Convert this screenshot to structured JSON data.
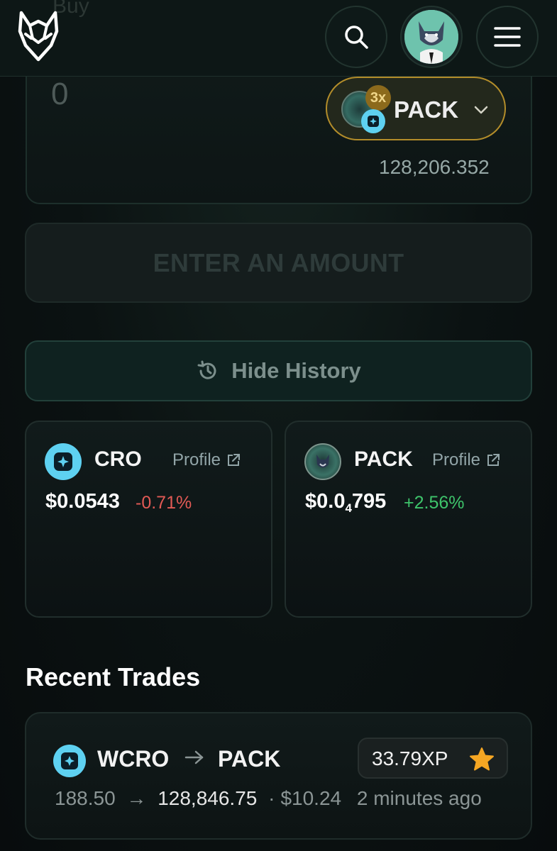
{
  "header": {
    "ghost_label": "Buy",
    "logo_icon": "fox-logo-icon",
    "search_icon": "search-icon",
    "avatar_icon": "wolf-avatar-icon",
    "menu_icon": "hamburger-menu-icon"
  },
  "buy": {
    "amount": "0",
    "token": {
      "symbol": "PACK",
      "multiplier": "3x",
      "icon": "pack-token-icon",
      "chain_icon": "cro-chain-icon"
    },
    "balance": "128,206.352"
  },
  "actions": {
    "enter_amount": "ENTER AN AMOUNT",
    "hide_history": "Hide History"
  },
  "tokens": [
    {
      "symbol": "CRO",
      "profile_label": "Profile",
      "price": "$0.0543",
      "change": "-0.71%",
      "direction": "down",
      "color": "#e25a55"
    },
    {
      "symbol": "PACK",
      "profile_label": "Profile",
      "price_prefix": "$0.0",
      "price_subscript": "4",
      "price_suffix": "795",
      "change": "+2.56%",
      "direction": "up",
      "color": "#3ec46b"
    }
  ],
  "recent_trades": {
    "title": "Recent Trades",
    "items": [
      {
        "from": "WCRO",
        "to": "PACK",
        "xp": "33.79XP",
        "amount_in": "188.50",
        "amount_out": "128,846.75",
        "usd": "$10.24",
        "time": "2 minutes ago"
      }
    ]
  },
  "colors": {
    "accent_gold": "#b38d2a",
    "cro_blue": "#5ed1f1",
    "positive": "#3ec46b",
    "negative": "#e25a55",
    "star": "#f5a623"
  }
}
